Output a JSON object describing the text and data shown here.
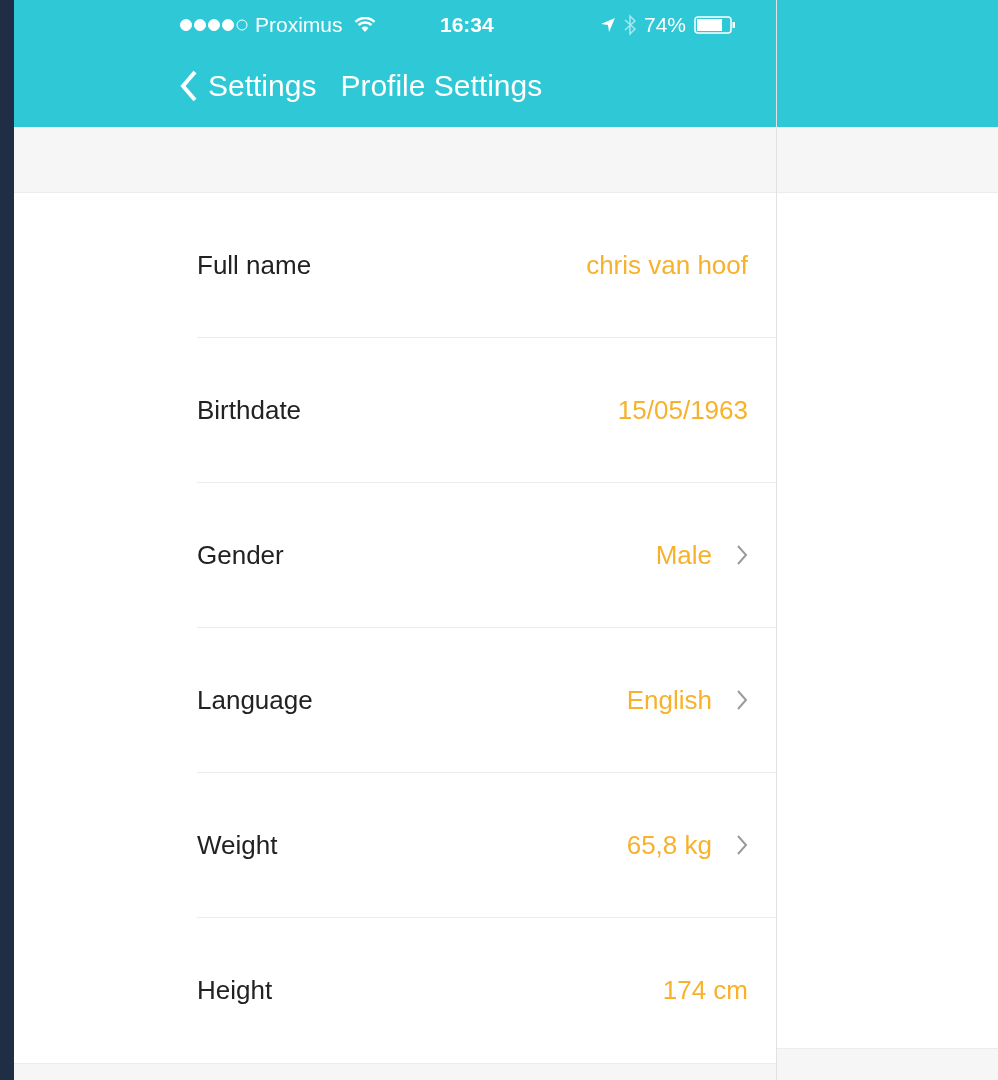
{
  "status_bar": {
    "carrier": "Proximus",
    "time": "16:34",
    "battery": "74%"
  },
  "nav": {
    "back": "Settings",
    "title": "Profile Settings"
  },
  "rows": [
    {
      "label": "Full name",
      "value": "chris van hoof",
      "disclosure": false
    },
    {
      "label": "Birthdate",
      "value": "15/05/1963",
      "disclosure": false
    },
    {
      "label": "Gender",
      "value": "Male",
      "disclosure": true
    },
    {
      "label": "Language",
      "value": "English",
      "disclosure": true
    },
    {
      "label": "Weight",
      "value": "65,8 kg",
      "disclosure": true
    },
    {
      "label": "Height",
      "value": "174 cm",
      "disclosure": false
    }
  ]
}
